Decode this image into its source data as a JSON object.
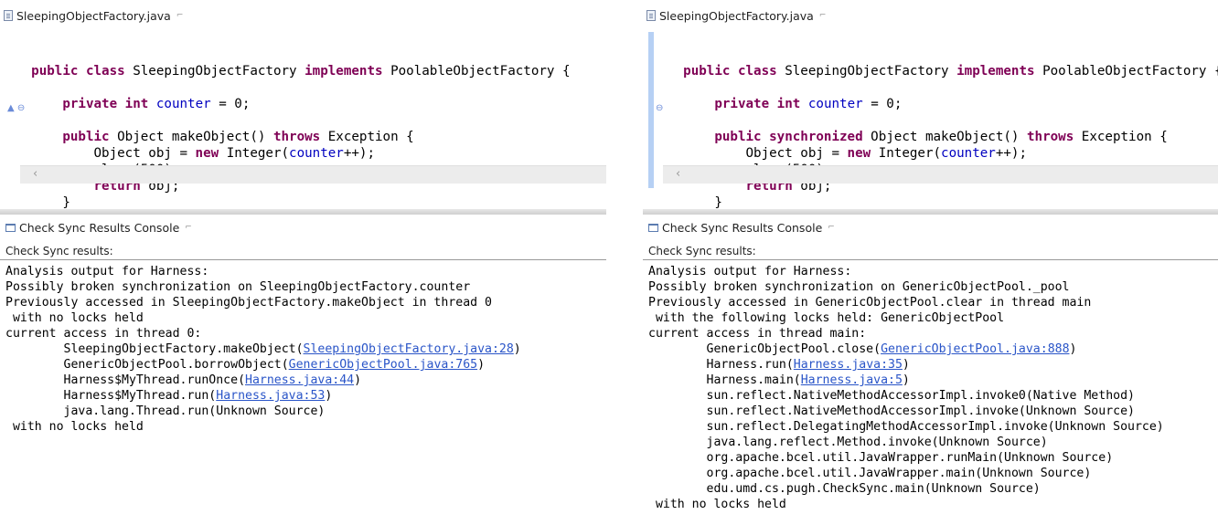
{
  "left": {
    "editor": {
      "tab_label": "SleepingObjectFactory.java",
      "close_glyph": "⌐"
    },
    "code": [
      [
        {
          "t": "    "
        },
        {
          "t": "public class",
          "c": "kw"
        },
        {
          "t": " SleepingObjectFactory "
        },
        {
          "t": "implements",
          "c": "kw"
        },
        {
          "t": " PoolableObjectFactory {"
        }
      ],
      [
        {
          "t": ""
        }
      ],
      [
        {
          "t": "        "
        },
        {
          "t": "private int",
          "c": "kw"
        },
        {
          "t": " "
        },
        {
          "t": "counter",
          "c": "fld"
        },
        {
          "t": " = 0;"
        }
      ],
      [
        {
          "t": ""
        }
      ],
      [
        {
          "t": "        "
        },
        {
          "t": "public",
          "c": "kw"
        },
        {
          "t": " Object makeObject() "
        },
        {
          "t": "throws",
          "c": "kw"
        },
        {
          "t": " Exception {"
        }
      ],
      [
        {
          "t": "            Object obj = "
        },
        {
          "t": "new",
          "c": "kw"
        },
        {
          "t": " Integer("
        },
        {
          "t": "counter",
          "c": "fld"
        },
        {
          "t": "++);"
        }
      ],
      [
        {
          "t": "            sleep(500);"
        }
      ],
      [
        {
          "t": "            "
        },
        {
          "t": "return",
          "c": "kw"
        },
        {
          "t": " obj;"
        }
      ],
      [
        {
          "t": "        }"
        }
      ]
    ],
    "console": {
      "tab_label": "Check Sync Results Console",
      "close_glyph": "⌐",
      "results_label": "Check Sync results:",
      "lines": [
        [
          {
            "t": "Analysis output for Harness:"
          }
        ],
        [
          {
            "t": "Possibly broken synchronization on SleepingObjectFactory.counter"
          }
        ],
        [
          {
            "t": "Previously accessed in SleepingObjectFactory.makeObject in thread 0"
          }
        ],
        [
          {
            "t": " with no locks held"
          }
        ],
        [
          {
            "t": "current access in thread 0:"
          }
        ],
        [
          {
            "t": "        SleepingObjectFactory.makeObject("
          },
          {
            "t": "SleepingObjectFactory.java:28",
            "c": "lnk"
          },
          {
            "t": ")"
          }
        ],
        [
          {
            "t": "        GenericObjectPool.borrowObject("
          },
          {
            "t": "GenericObjectPool.java:765",
            "c": "lnk"
          },
          {
            "t": ")"
          }
        ],
        [
          {
            "t": "        Harness$MyThread.runOnce("
          },
          {
            "t": "Harness.java:44",
            "c": "lnk"
          },
          {
            "t": ")"
          }
        ],
        [
          {
            "t": "        Harness$MyThread.run("
          },
          {
            "t": "Harness.java:53",
            "c": "lnk"
          },
          {
            "t": ")"
          }
        ],
        [
          {
            "t": "        java.lang.Thread.run(Unknown Source)"
          }
        ],
        [
          {
            "t": " with no locks held"
          }
        ]
      ]
    }
  },
  "right": {
    "editor": {
      "tab_label": "SleepingObjectFactory.java",
      "close_glyph": "⌐"
    },
    "code": [
      [
        {
          "t": "    "
        },
        {
          "t": "public class",
          "c": "kw"
        },
        {
          "t": " SleepingObjectFactory "
        },
        {
          "t": "implements",
          "c": "kw"
        },
        {
          "t": " PoolableObjectFactory {"
        }
      ],
      [
        {
          "t": ""
        }
      ],
      [
        {
          "t": "        "
        },
        {
          "t": "private int",
          "c": "kw"
        },
        {
          "t": " "
        },
        {
          "t": "counter",
          "c": "fld"
        },
        {
          "t": " = 0;"
        }
      ],
      [
        {
          "t": ""
        }
      ],
      [
        {
          "t": "        "
        },
        {
          "t": "public synchronized",
          "c": "kw"
        },
        {
          "t": " Object makeObject() "
        },
        {
          "t": "throws",
          "c": "kw"
        },
        {
          "t": " Exception {"
        }
      ],
      [
        {
          "t": "            Object obj = "
        },
        {
          "t": "new",
          "c": "kw"
        },
        {
          "t": " Integer("
        },
        {
          "t": "counter",
          "c": "fld"
        },
        {
          "t": "++);"
        }
      ],
      [
        {
          "t": "            sleep(500);"
        }
      ],
      [
        {
          "t": "            "
        },
        {
          "t": "return",
          "c": "kw"
        },
        {
          "t": " obj;"
        }
      ],
      [
        {
          "t": "        }"
        }
      ]
    ],
    "console": {
      "tab_label": "Check Sync Results Console",
      "close_glyph": "⌐",
      "results_label": "Check Sync results:",
      "lines": [
        [
          {
            "t": "Analysis output for Harness:"
          }
        ],
        [
          {
            "t": "Possibly broken synchronization on GenericObjectPool._pool"
          }
        ],
        [
          {
            "t": "Previously accessed in GenericObjectPool.clear in thread main"
          }
        ],
        [
          {
            "t": " with the following locks held: GenericObjectPool"
          }
        ],
        [
          {
            "t": "current access in thread main:"
          }
        ],
        [
          {
            "t": "        GenericObjectPool.close("
          },
          {
            "t": "GenericObjectPool.java:888",
            "c": "lnk"
          },
          {
            "t": ")"
          }
        ],
        [
          {
            "t": "        Harness.run("
          },
          {
            "t": "Harness.java:35",
            "c": "lnk"
          },
          {
            "t": ")"
          }
        ],
        [
          {
            "t": "        Harness.main("
          },
          {
            "t": "Harness.java:5",
            "c": "lnk"
          },
          {
            "t": ")"
          }
        ],
        [
          {
            "t": "        sun.reflect.NativeMethodAccessorImpl.invoke0(Native Method)"
          }
        ],
        [
          {
            "t": "        sun.reflect.NativeMethodAccessorImpl.invoke(Unknown Source)"
          }
        ],
        [
          {
            "t": "        sun.reflect.DelegatingMethodAccessorImpl.invoke(Unknown Source)"
          }
        ],
        [
          {
            "t": "        java.lang.reflect.Method.invoke(Unknown Source)"
          }
        ],
        [
          {
            "t": "        org.apache.bcel.util.JavaWrapper.runMain(Unknown Source)"
          }
        ],
        [
          {
            "t": "        org.apache.bcel.util.JavaWrapper.main(Unknown Source)"
          }
        ],
        [
          {
            "t": "        edu.umd.cs.pugh.CheckSync.main(Unknown Source)"
          }
        ],
        [
          {
            "t": " with no locks held"
          }
        ]
      ]
    }
  }
}
